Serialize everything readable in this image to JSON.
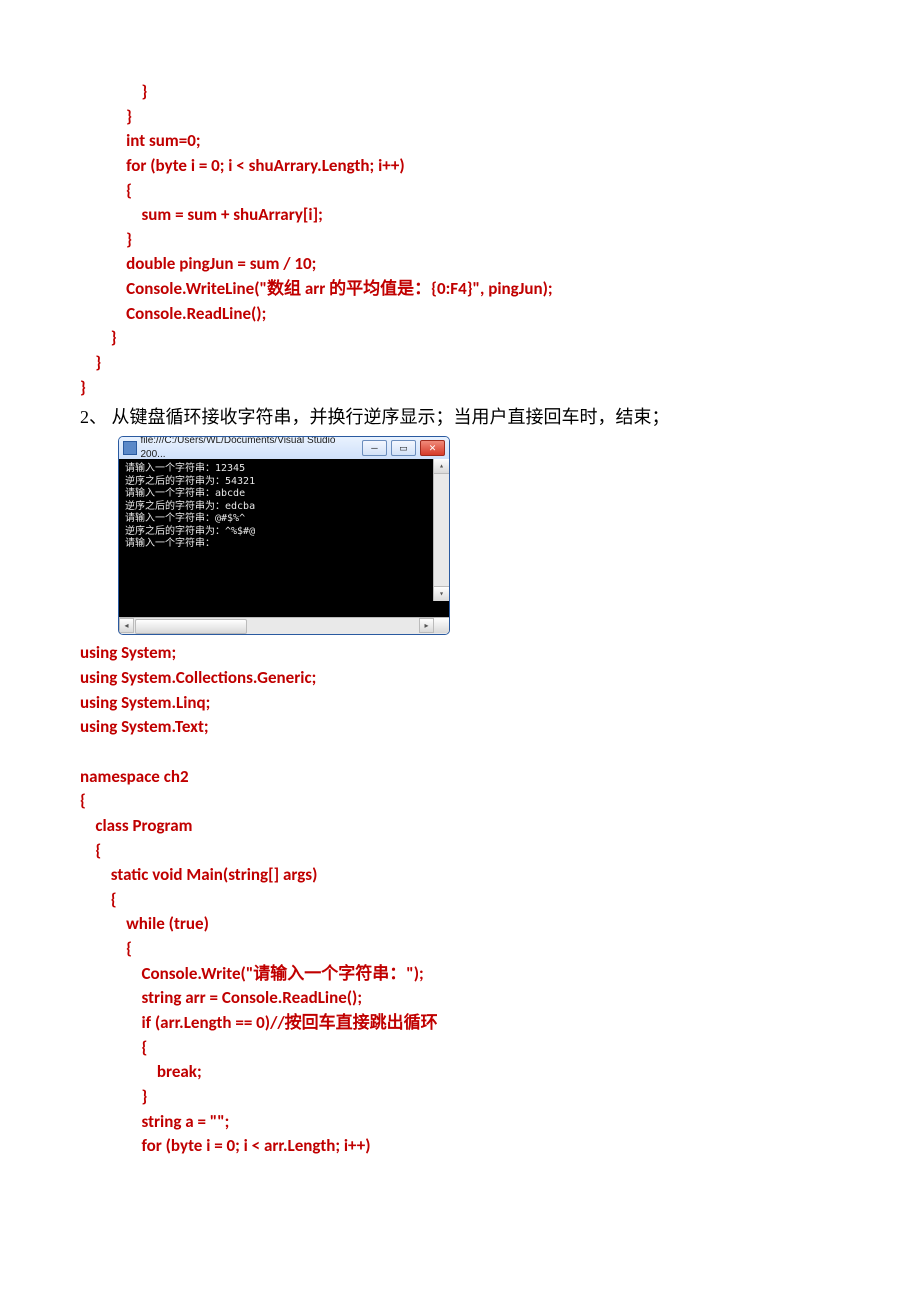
{
  "code1": "                }\n            }\n            int sum=0;\n            for (byte i = 0; i < shuArrary.Length; i++)\n            {\n                sum = sum + shuArrary[i];\n            }\n            double pingJun = sum / 10;\n            Console.WriteLine(\"数组 arr 的平均值是：{0:F4}\", pingJun);\n            Console.ReadLine();\n        }\n    }\n}",
  "question2": "2、 从键盘循环接收字符串，并换行逆序显示；当用户直接回车时，结束；",
  "window": {
    "title": "file:///C:/Users/WL/Documents/Visual Studio 200...",
    "lines": [
      "请输入一个字符串：12345",
      "逆序之后的字符串为：54321",
      "请输入一个字符串：abcde",
      "逆序之后的字符串为：edcba",
      "请输入一个字符串：@#$%^",
      "逆序之后的字符串为：^%$#@",
      "请输入一个字符串："
    ]
  },
  "code2": "using System;\nusing System.Collections.Generic;\nusing System.Linq;\nusing System.Text;\n\nnamespace ch2\n{\n    class Program\n    {\n        static void Main(string[] args)\n        {\n            while (true)\n            {\n                Console.Write(\"请输入一个字符串：\");\n                string arr = Console.ReadLine();\n                if (arr.Length == 0)//按回车直接跳出循环\n                {\n                    break;\n                }\n                string a = \"\";\n                for (byte i = 0; i < arr.Length; i++)"
}
